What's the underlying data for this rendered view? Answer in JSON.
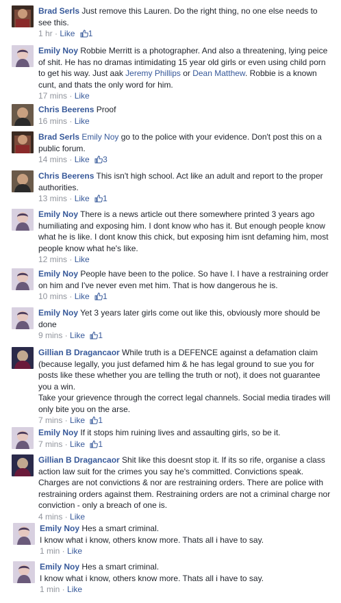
{
  "like_label": "Like",
  "colors": {
    "link": "#365899",
    "meta": "#90949c",
    "text": "#1d2129"
  },
  "comments": [
    {
      "author": "Brad Serls",
      "text": "Just remove this Lauren. Do the right thing, no one else needs to see this.",
      "time": "1 hr",
      "likes": "1",
      "avatar": "avatar-brad"
    },
    {
      "author": "Emily Noy",
      "text_parts": [
        "Robbie Merritt is a photographer. And also a threatening, lying peice of shit. He has no dramas intimidating 15 year old girls or even using child porn to get his way. Just aak ",
        "Jeremy Phillips",
        " or ",
        "Dean Matthew",
        ". Robbie is a known cunt, and thats the only word for him."
      ],
      "time": "17 mins",
      "avatar": "avatar-emily"
    },
    {
      "author": "Chris Beerens",
      "text": "Proof",
      "time": "16 mins",
      "avatar": "avatar-chris"
    },
    {
      "author": "Brad Serls",
      "mention": "Emily Noy",
      "text": " go to the police with your evidence. Don't post this on a public forum.",
      "time": "14 mins",
      "likes": "3",
      "avatar": "avatar-brad"
    },
    {
      "author": "Chris Beerens",
      "text": "This isn't high school. Act like an adult and report to the proper authorities.",
      "time": "13 mins",
      "likes": "1",
      "avatar": "avatar-chris"
    },
    {
      "author": "Emily Noy",
      "text": "There is a news article out there somewhere printed 3 years ago humiliating and exposing him. I dont know who has it. But enough people know what he is like. I dont know this chick, but exposing him isnt defaming him, most people know what he's like.",
      "time": "12 mins",
      "avatar": "avatar-emily"
    },
    {
      "author": "Emily Noy",
      "text": "People have been to the police. So have I. I have a restraining order on him and I've never even met him. That is how dangerous he is.",
      "time": "10 mins",
      "likes": "1",
      "avatar": "avatar-emily"
    },
    {
      "author": "Emily Noy",
      "text": "Yet 3 years later girls come out like this, obviously more should be done",
      "time": "9 mins",
      "likes": "1",
      "avatar": "avatar-emily"
    },
    {
      "author": "Gillian B Dragancaor",
      "text": "While truth is a DEFENCE against a defamation claim (because legally, you just defamed him & he has legal ground to sue you for posts like these whether you are telling the truth or not), it does not guarantee you a win.",
      "text2": "Take your grievence through the correct legal channels. Social media tirades will only bite you on the arse.",
      "time": "7 mins",
      "likes": "1",
      "avatar": "avatar-gillian"
    },
    {
      "author": "Emily Noy",
      "text": "If it stops him ruining lives and assaulting girls, so be it.",
      "time": "7 mins",
      "likes": "1",
      "avatar": "avatar-emily"
    },
    {
      "author": "Gillian B Dragancaor",
      "text": "Shit like this doesnt stop it. If its so rife, organise a class action law suit for the crimes you say he's committed. Convictions speak. Charges are not convictions & nor are restraining orders. There are police with restraining orders against them. Restraining orders are not a criminal charge nor conviction - only a breach of one is.",
      "time": "4 mins",
      "avatar": "avatar-gillian"
    },
    {
      "author": "Emily Noy",
      "text": "Hes a smart criminal.",
      "text2": "I know what i know, others know more. Thats all i have to say.",
      "time": "1 min",
      "avatar": "avatar-emily"
    },
    {
      "author": "Emily Noy",
      "text": "Hes a smart criminal.",
      "text2": "I know what i know, others know more. Thats all i have to say.",
      "time": "1 min",
      "avatar": "avatar-emily"
    }
  ]
}
